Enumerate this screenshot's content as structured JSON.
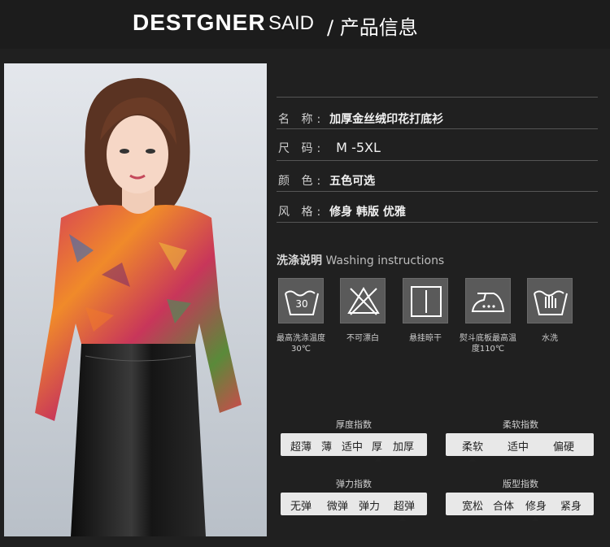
{
  "header": {
    "brand": "DESTGNER",
    "brand_said": "SAID",
    "subtitle": "/ 产品信息"
  },
  "info": [
    {
      "key": "名 称:",
      "value": "加厚金丝绒印花打底衫"
    },
    {
      "key": "尺 码:",
      "value": "M -5XL"
    },
    {
      "key": "颜 色:",
      "value": "五色可选"
    },
    {
      "key": "风 格:",
      "value": "修身 韩版 优雅"
    }
  ],
  "washing": {
    "title_cn": "洗涤说明",
    "title_en": "Washing instructions",
    "items": [
      {
        "icon": "wash-30-icon",
        "label": "最高洗涤温度30℃",
        "temp": "30"
      },
      {
        "icon": "no-bleach-icon",
        "label": "不可漂白"
      },
      {
        "icon": "hang-dry-icon",
        "label": "悬挂晾干"
      },
      {
        "icon": "iron-icon",
        "label": "熨斗底板最高温度110℃"
      },
      {
        "icon": "hand-wash-icon",
        "label": "水洗"
      }
    ]
  },
  "indices": [
    {
      "title": "厚度指数",
      "options": [
        "超薄",
        "薄",
        "适中",
        "厚",
        "加厚"
      ],
      "selected": "厚"
    },
    {
      "title": "柔软指数",
      "options": [
        "柔软",
        "适中",
        "偏硬"
      ],
      "selected": "柔软"
    },
    {
      "title": "弹力指数",
      "options": [
        "无弹",
        "微弹",
        "弹力",
        "超弹"
      ],
      "selected": "超弹"
    },
    {
      "title": "版型指数",
      "options": [
        "宽松",
        "合体",
        "修身",
        "紧身"
      ],
      "selected": "修身"
    }
  ],
  "colors": {
    "background": "#202020",
    "header": "#1c1c1c",
    "bar": "#e8e8e8",
    "icon_box": "#5a5a5a"
  }
}
